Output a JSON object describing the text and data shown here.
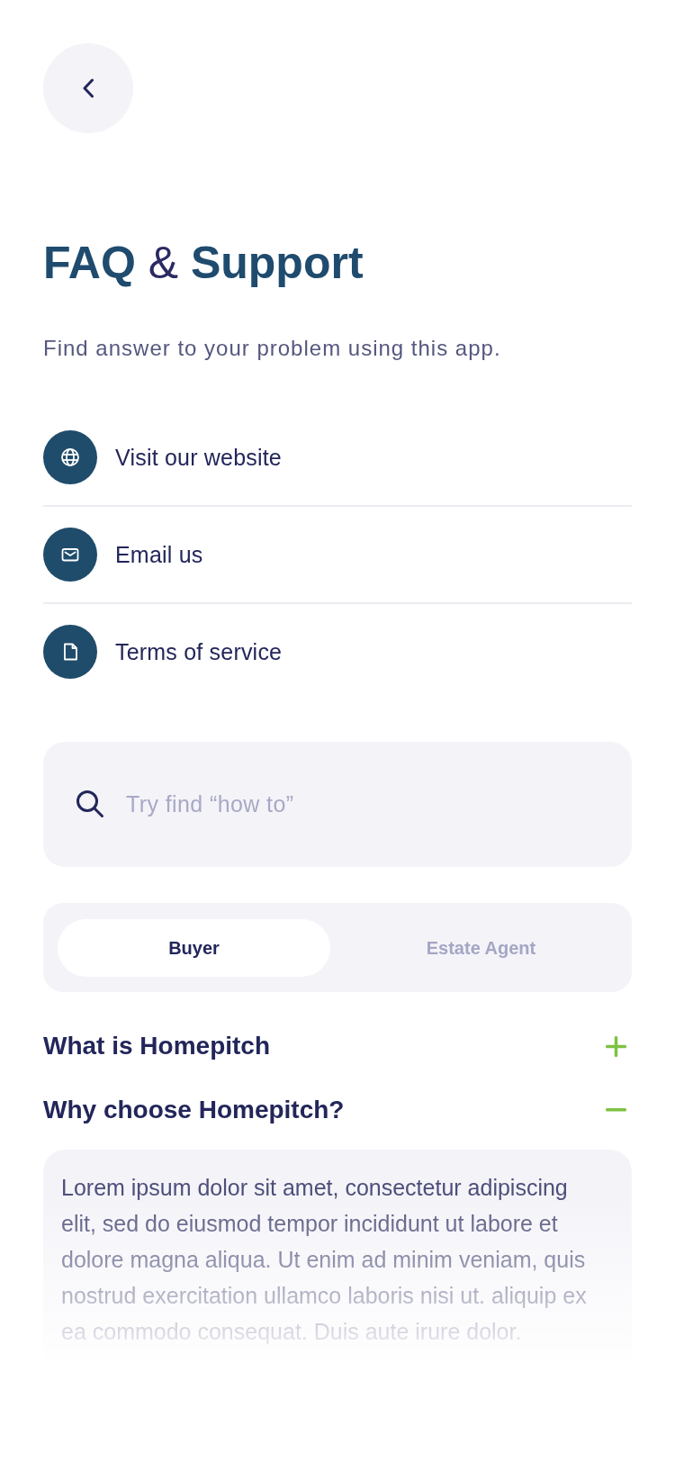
{
  "header": {
    "title": "**FAQ** & **Support**",
    "subtitle": "Find answer to your problem using this app."
  },
  "links": [
    {
      "kind": "website",
      "label": "Visit our website"
    },
    {
      "kind": "email",
      "label": "Email us"
    },
    {
      "kind": "terms",
      "label": "Terms of service"
    }
  ],
  "search": {
    "placeholder": "Try find “how to”"
  },
  "tabs": [
    {
      "label": "Buyer",
      "selected": true
    },
    {
      "label": "Estate Agent",
      "selected": false
    }
  ],
  "faq": [
    {
      "question": "What is Homepitch",
      "expanded": false
    },
    {
      "question": "Why choose Homepitch?",
      "expanded": true,
      "answer": "Lorem ipsum dolor sit amet, consectetur adipiscing elit, sed do eiusmod tempor incididunt ut labore et dolore magna aliqua. Ut enim ad minim veniam, quis nostrud exercitation ullamco laboris nisi ut. aliquip ex ea commodo consequat. Duis aute irure dolor."
    }
  ]
}
